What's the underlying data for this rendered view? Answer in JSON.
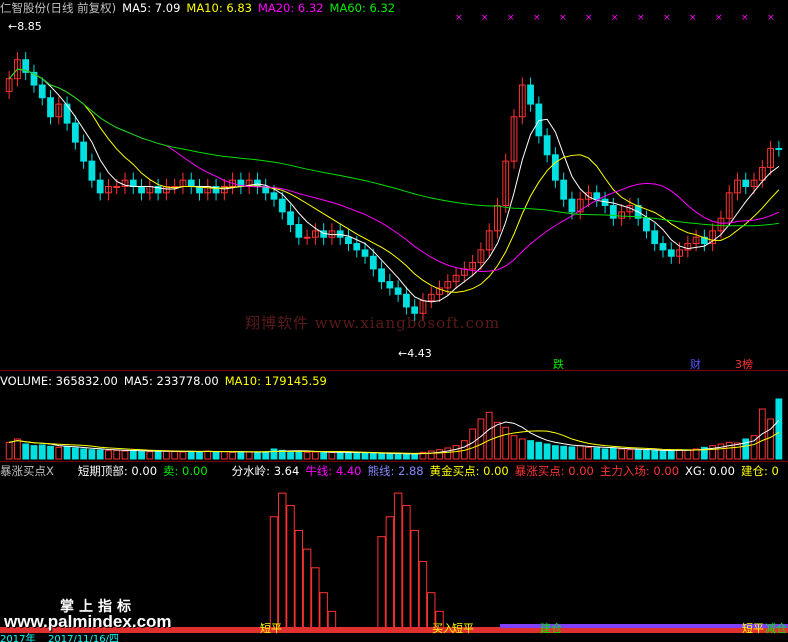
{
  "price_header": {
    "name": "仁智股份(日线 前复权)",
    "ma5": "MA5: 7.09",
    "ma10": "MA10: 6.83",
    "ma20": "MA20: 6.32",
    "ma60": "MA60: 6.32"
  },
  "price_annotations": {
    "high": "8.85",
    "low": "4.43",
    "tag1": "跌",
    "tag2": "财",
    "tag3": "3榜"
  },
  "volume_header": {
    "volume": "VOLUME: 365832.00",
    "ma5": "MA5: 233778.00",
    "ma10": "MA10: 179145.59"
  },
  "indicator_header": {
    "name": "暴涨买点X",
    "f1": "短期顶部: 0.00",
    "f2": "卖: 0.00",
    "f3": "分水岭: 3.64",
    "f4": "牛线: 4.40",
    "f5": "熊线: 2.88",
    "f6": "黄金买点: 0.00",
    "f7": "暴涨买点: 0.00",
    "f8": "主力入场: 0.00",
    "f9": "XG: 0.00",
    "f10": "建仓: 0"
  },
  "indicator_labels": {
    "l1": "短平",
    "l2": "买入",
    "l3": "短平",
    "l4": "建仓",
    "l5": "短平",
    "l6": "减仓"
  },
  "footer": {
    "year": "2017年",
    "date": "2017/11/16/四",
    "brand": "掌上指标",
    "site": "www.palmindex.com"
  },
  "watermark": "翔博软件 www.xiangbosoft.com",
  "colors": {
    "up": "#ff3232",
    "down": "#00e0e0",
    "ma5": "#ffffff",
    "ma10": "#ffff00",
    "ma20": "#ff00ff",
    "ma60": "#00e000",
    "grid": "#7a0000"
  },
  "chart_data": {
    "type": "candlestick",
    "price_range": [
      4.43,
      8.85
    ],
    "close": [
      8.2,
      8.5,
      8.3,
      8.1,
      7.9,
      7.6,
      7.8,
      7.5,
      7.2,
      6.9,
      6.6,
      6.4,
      6.5,
      6.5,
      6.6,
      6.5,
      6.4,
      6.5,
      6.4,
      6.5,
      6.5,
      6.6,
      6.5,
      6.4,
      6.5,
      6.4,
      6.5,
      6.6,
      6.5,
      6.6,
      6.5,
      6.4,
      6.3,
      6.1,
      5.9,
      5.7,
      5.7,
      5.8,
      5.7,
      5.8,
      5.7,
      5.6,
      5.5,
      5.4,
      5.2,
      5.0,
      4.9,
      4.8,
      4.6,
      4.5,
      4.7,
      4.8,
      4.9,
      5.0,
      5.1,
      5.2,
      5.3,
      5.5,
      5.8,
      6.2,
      6.9,
      7.6,
      8.1,
      7.8,
      7.3,
      7.0,
      6.6,
      6.3,
      6.1,
      6.3,
      6.4,
      6.3,
      6.2,
      6.0,
      6.1,
      6.2,
      6.0,
      5.8,
      5.6,
      5.5,
      5.4,
      5.5,
      5.6,
      5.7,
      5.6,
      5.8,
      6.0,
      6.4,
      6.6,
      6.5,
      6.6,
      6.8,
      7.1,
      7.09
    ],
    "volume": [
      50,
      60,
      45,
      40,
      42,
      38,
      35,
      36,
      33,
      30,
      28,
      27,
      25,
      26,
      24,
      25,
      23,
      22,
      24,
      23,
      22,
      21,
      23,
      22,
      24,
      21,
      22,
      20,
      22,
      21,
      20,
      22,
      30,
      26,
      24,
      22,
      20,
      21,
      19,
      20,
      21,
      18,
      19,
      17,
      18,
      16,
      15,
      16,
      14,
      15,
      20,
      24,
      28,
      33,
      40,
      55,
      90,
      120,
      140,
      110,
      95,
      70,
      60,
      55,
      50,
      45,
      40,
      38,
      36,
      40,
      35,
      33,
      30,
      32,
      30,
      28,
      27,
      26,
      25,
      24,
      26,
      28,
      27,
      30,
      35,
      40,
      45,
      50,
      48,
      60,
      70,
      150,
      120,
      180
    ],
    "indicator": [
      0,
      0,
      0,
      0,
      0,
      0,
      0,
      0,
      0,
      0,
      0,
      0,
      0,
      0,
      0,
      0,
      0,
      0,
      0,
      0,
      0,
      0,
      0,
      0,
      0,
      0,
      0,
      0,
      0,
      0,
      0,
      0,
      3.64,
      4.4,
      4.0,
      3.2,
      2.6,
      2.0,
      1.2,
      0.6,
      0,
      0,
      0,
      0,
      0,
      3.0,
      3.64,
      4.4,
      4.0,
      3.2,
      2.2,
      1.2,
      0.6,
      0,
      0,
      0,
      0,
      0,
      0,
      0,
      0,
      0,
      0,
      0,
      0,
      0,
      0,
      0,
      0,
      0,
      0,
      0,
      0,
      0,
      0,
      0,
      0,
      0,
      0,
      0,
      0,
      0,
      0,
      0,
      0,
      0,
      0,
      0,
      0,
      0,
      0,
      0,
      0,
      0
    ]
  }
}
